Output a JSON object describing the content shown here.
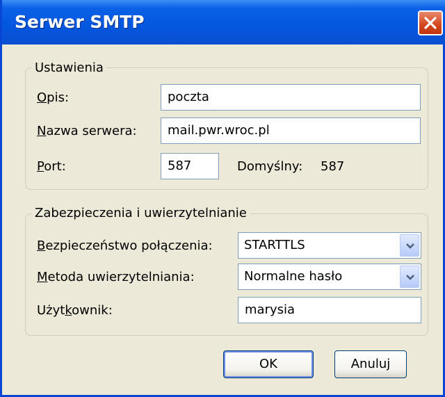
{
  "window": {
    "title": "Serwer SMTP"
  },
  "settings": {
    "group_title": "Ustawienia",
    "description": {
      "label_accel": "O",
      "label_rest": "pis:",
      "value": "poczta"
    },
    "server": {
      "label_accel": "N",
      "label_rest": "azwa serwera:",
      "value": "mail.pwr.wroc.pl"
    },
    "port": {
      "label_accel": "P",
      "label_rest": "ort:",
      "value": "587",
      "default_label": "Domyślny:",
      "default_value": "587"
    }
  },
  "security": {
    "group_title": "Zabezpieczenia i uwierzytelnianie",
    "connection": {
      "label_accel": "B",
      "label_rest": "ezpieczeństwo połączenia:",
      "value": "STARTTLS"
    },
    "auth_method": {
      "label_accel": "M",
      "label_rest": "etoda uwierzytelniania:",
      "value": "Normalne hasło"
    },
    "user": {
      "label_before": "Użyt",
      "label_accel": "k",
      "label_after": "ownik:",
      "value": "marysia"
    }
  },
  "buttons": {
    "ok": "OK",
    "cancel": "Anuluj"
  },
  "colors": {
    "titlebar": "#0457e0",
    "dialog_bg": "#ece9d8",
    "close": "#d4451e",
    "field_border": "#7f9db9"
  },
  "icons": {
    "close": "close-icon",
    "dropdown": "chevron-down-icon"
  }
}
